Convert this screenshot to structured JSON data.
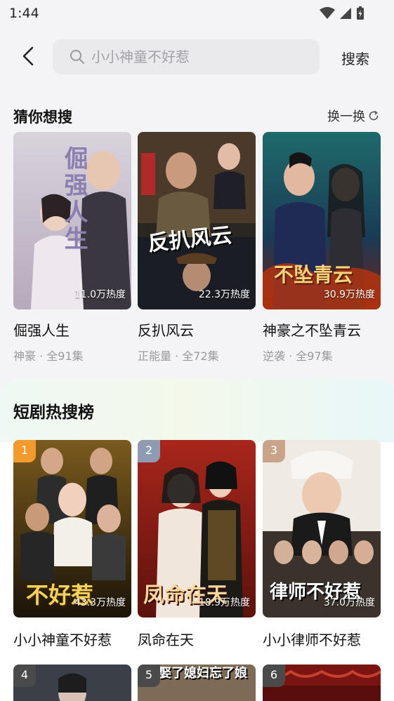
{
  "status": {
    "time": "1:44"
  },
  "search": {
    "placeholder": "小小神童不好惹",
    "button": "搜索"
  },
  "guess": {
    "title": "猜你想搜",
    "refresh": "换一换",
    "items": [
      {
        "title": "倔强人生",
        "meta": "神豪 · 全91集",
        "heat": "11.0万热度",
        "poster_text": "倔强人生"
      },
      {
        "title": "反扒风云",
        "meta": "正能量 · 全72集",
        "heat": "22.3万热度",
        "poster_text": "反扒风云"
      },
      {
        "title": "神豪之不坠青云",
        "meta": "逆袭 · 全97集",
        "heat": "30.9万热度",
        "poster_text": "不坠青云"
      }
    ]
  },
  "hot": {
    "title": "短剧热搜榜",
    "items": [
      {
        "rank": "1",
        "title": "小小神童不好惹",
        "heat": "43.3万热度",
        "poster_text": "不好惹"
      },
      {
        "rank": "2",
        "title": "凤命在天",
        "heat": "18.9万热度",
        "poster_text": "凤命在天"
      },
      {
        "rank": "3",
        "title": "小小律师不好惹",
        "heat": "37.0万热度",
        "poster_text": "律师不好惹"
      },
      {
        "rank": "4"
      },
      {
        "rank": "5",
        "poster_text": "娶了媳妇忘了娘"
      },
      {
        "rank": "6"
      }
    ]
  },
  "colors": {
    "rank1": "#f29a2e",
    "rank2": "#8f9bb3",
    "rank3": "#c9a48a",
    "rank_other": "#4a4a4a"
  }
}
